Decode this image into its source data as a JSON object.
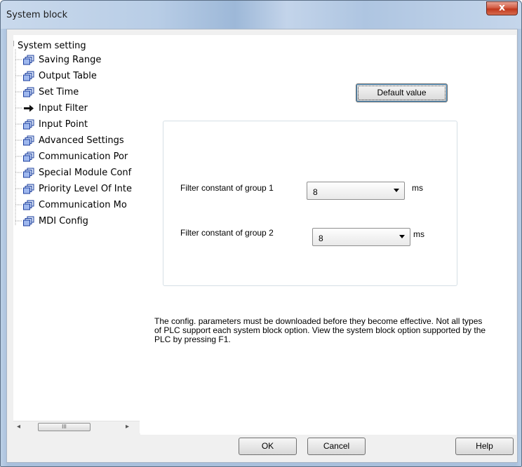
{
  "window": {
    "title": "System block",
    "close_glyph": "x"
  },
  "tree": {
    "root": "System setting",
    "items": [
      {
        "label": "Saving Range",
        "icon": "page-stack-icon"
      },
      {
        "label": "Output Table",
        "icon": "page-stack-icon"
      },
      {
        "label": "Set Time",
        "icon": "page-stack-icon"
      },
      {
        "label": "Input Filter",
        "icon": "arrow-right-icon"
      },
      {
        "label": "Input Point",
        "icon": "page-stack-icon"
      },
      {
        "label": "Advanced Settings",
        "icon": "page-stack-icon"
      },
      {
        "label": "Communication Por",
        "icon": "page-stack-icon"
      },
      {
        "label": "Special Module Conf",
        "icon": "page-stack-icon"
      },
      {
        "label": "Priority Level Of Inte",
        "icon": "page-stack-icon"
      },
      {
        "label": "Communication Mo",
        "icon": "page-stack-icon"
      },
      {
        "label": "MDI Config",
        "icon": "page-stack-icon"
      }
    ],
    "scroll_left": "◂",
    "scroll_right": "▸",
    "scroll_thumb": "III"
  },
  "panel": {
    "default_button": "Default value",
    "filters": [
      {
        "label": "Filter constant of group 1",
        "value": "8",
        "unit": "ms"
      },
      {
        "label": "Filter constant of group 2",
        "value": "8",
        "unit": "ms"
      }
    ],
    "note": "The config. parameters must be downloaded before they become effective. Not all types of PLC support each system block option. View the system block option supported by the PLC by pressing F1."
  },
  "footer": {
    "ok": "OK",
    "cancel": "Cancel",
    "help": "Help"
  },
  "colors": {
    "frame": "#a9c0dc",
    "close": "#c1381d",
    "focus": "#3c7fb1"
  }
}
